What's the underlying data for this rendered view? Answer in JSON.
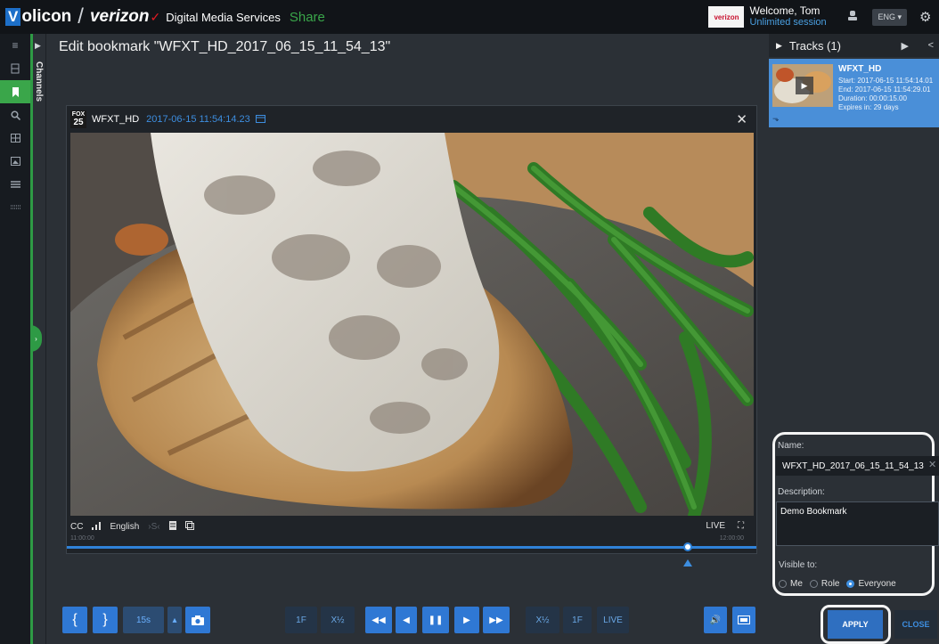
{
  "header": {
    "brand_v": "V",
    "brand_rest": "olicon",
    "brand_partner": "verizon",
    "brand_check": "✓",
    "brand_service": "Digital Media Services",
    "brand_share": "Share",
    "welcome": "Welcome, Tom",
    "session": "Unlimited session",
    "language": "ENG ▾"
  },
  "sidebar": {
    "channels_label": "Channels"
  },
  "page": {
    "title": "Edit bookmark \"WFXT_HD_2017_06_15_11_54_13\""
  },
  "player": {
    "logo_text": "FOX",
    "logo_num": "25",
    "channel": "WFXT_HD",
    "timestamp": "2017-06-15 11:54:14.23",
    "cc": "CC",
    "language": "English",
    "live": "LIVE",
    "time_start": "11:00:00",
    "time_end": "12:00:00",
    "progress_fraction": 0.9
  },
  "tracks": {
    "header": "Tracks (1)",
    "items": [
      {
        "title": "WFXT_HD",
        "start": "Start: 2017-06-15 11:54:14.01",
        "end": "End: 2017-06-15 11:54:29.01",
        "duration": "Duration: 00:00:15.00",
        "expires": "Expires in: 29 days"
      }
    ]
  },
  "form": {
    "name_label": "Name:",
    "name_value": "WFXT_HD_2017_06_15_11_54_13",
    "description_label": "Description:",
    "description_value": "Demo Bookmark",
    "visible_label": "Visible to:",
    "visible_options": [
      "Me",
      "Role",
      "Everyone"
    ],
    "visible_selected": "Everyone",
    "apply": "APPLY",
    "close": "CLOSE"
  },
  "transport": {
    "mark_in": "{",
    "mark_out": "}",
    "step": "15s",
    "step_caret": "▴",
    "frame_back": "1F",
    "speed_back": "X½",
    "speed_fwd": "X½",
    "frame_fwd": "1F",
    "live": "LIVE"
  },
  "colors": {
    "accent_blue": "#2f78d4",
    "brand_green": "#3aa64a",
    "track_card": "#4a8fd8"
  }
}
